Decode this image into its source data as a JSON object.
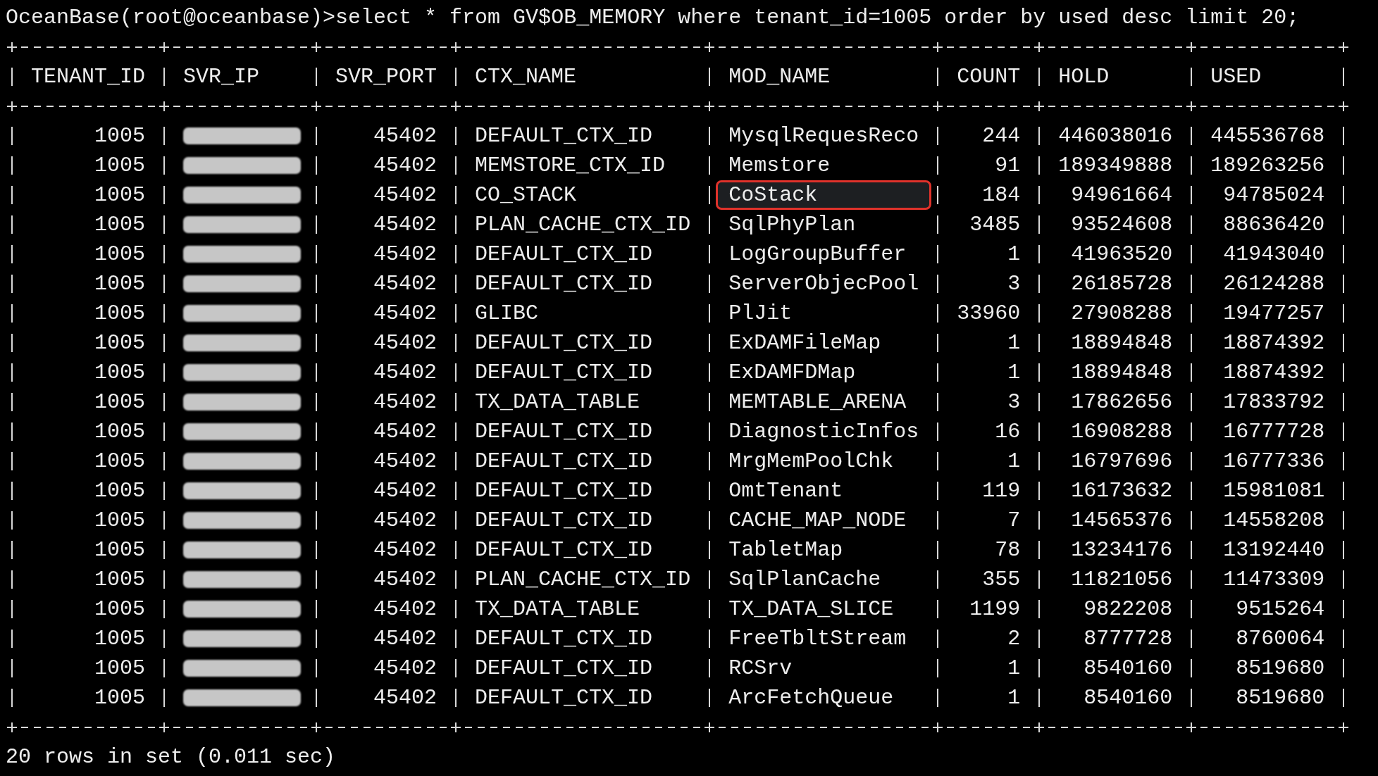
{
  "terminal": {
    "command": "OceanBase(root@oceanbase)>select * from GV$OB_MEMORY where tenant_id=1005 order by used desc limit 20;",
    "table": {
      "columns": [
        {
          "label": "TENANT_ID",
          "kind": "number"
        },
        {
          "label": "SVR_IP",
          "kind": "redacted"
        },
        {
          "label": "SVR_PORT",
          "kind": "number"
        },
        {
          "label": "CTX_NAME",
          "kind": "text"
        },
        {
          "label": "MOD_NAME",
          "kind": "text"
        },
        {
          "label": "COUNT",
          "kind": "number"
        },
        {
          "label": "HOLD",
          "kind": "number"
        },
        {
          "label": "USED",
          "kind": "number"
        }
      ],
      "rows": [
        {
          "cells": [
            "1005",
            "",
            "45402",
            "DEFAULT_CTX_ID",
            "MysqlRequesReco",
            "244",
            "446038016",
            "445536768"
          ],
          "ip_redacted": true,
          "highlighted": false
        },
        {
          "cells": [
            "1005",
            "",
            "45402",
            "MEMSTORE_CTX_ID",
            "Memstore",
            "91",
            "189349888",
            "189263256"
          ],
          "ip_redacted": true,
          "highlighted": false
        },
        {
          "cells": [
            "1005",
            "",
            "45402",
            "CO_STACK",
            "CoStack",
            "184",
            "94961664",
            "94785024"
          ],
          "ip_redacted": true,
          "highlighted": true
        },
        {
          "cells": [
            "1005",
            "",
            "45402",
            "PLAN_CACHE_CTX_ID",
            "SqlPhyPlan",
            "3485",
            "93524608",
            "88636420"
          ],
          "ip_redacted": true,
          "highlighted": false
        },
        {
          "cells": [
            "1005",
            "",
            "45402",
            "DEFAULT_CTX_ID",
            "LogGroupBuffer",
            "1",
            "41963520",
            "41943040"
          ],
          "ip_redacted": true,
          "highlighted": false
        },
        {
          "cells": [
            "1005",
            "",
            "45402",
            "DEFAULT_CTX_ID",
            "ServerObjecPool",
            "3",
            "26185728",
            "26124288"
          ],
          "ip_redacted": true,
          "highlighted": false
        },
        {
          "cells": [
            "1005",
            "",
            "45402",
            "GLIBC",
            "PlJit",
            "33960",
            "27908288",
            "19477257"
          ],
          "ip_redacted": true,
          "highlighted": false
        },
        {
          "cells": [
            "1005",
            "",
            "45402",
            "DEFAULT_CTX_ID",
            "ExDAMFileMap",
            "1",
            "18894848",
            "18874392"
          ],
          "ip_redacted": true,
          "highlighted": false
        },
        {
          "cells": [
            "1005",
            "",
            "45402",
            "DEFAULT_CTX_ID",
            "ExDAMFDMap",
            "1",
            "18894848",
            "18874392"
          ],
          "ip_redacted": true,
          "highlighted": false
        },
        {
          "cells": [
            "1005",
            "",
            "45402",
            "TX_DATA_TABLE",
            "MEMTABLE_ARENA",
            "3",
            "17862656",
            "17833792"
          ],
          "ip_redacted": true,
          "highlighted": false
        },
        {
          "cells": [
            "1005",
            "",
            "45402",
            "DEFAULT_CTX_ID",
            "DiagnosticInfos",
            "16",
            "16908288",
            "16777728"
          ],
          "ip_redacted": true,
          "highlighted": false
        },
        {
          "cells": [
            "1005",
            "",
            "45402",
            "DEFAULT_CTX_ID",
            "MrgMemPoolChk",
            "1",
            "16797696",
            "16777336"
          ],
          "ip_redacted": true,
          "highlighted": false
        },
        {
          "cells": [
            "1005",
            "",
            "45402",
            "DEFAULT_CTX_ID",
            "OmtTenant",
            "119",
            "16173632",
            "15981081"
          ],
          "ip_redacted": true,
          "highlighted": false
        },
        {
          "cells": [
            "1005",
            "",
            "45402",
            "DEFAULT_CTX_ID",
            "CACHE_MAP_NODE",
            "7",
            "14565376",
            "14558208"
          ],
          "ip_redacted": true,
          "highlighted": false
        },
        {
          "cells": [
            "1005",
            "",
            "45402",
            "DEFAULT_CTX_ID",
            "TabletMap",
            "78",
            "13234176",
            "13192440"
          ],
          "ip_redacted": true,
          "highlighted": false
        },
        {
          "cells": [
            "1005",
            "",
            "45402",
            "PLAN_CACHE_CTX_ID",
            "SqlPlanCache",
            "355",
            "11821056",
            "11473309"
          ],
          "ip_redacted": true,
          "highlighted": false
        },
        {
          "cells": [
            "1005",
            "",
            "45402",
            "TX_DATA_TABLE",
            "TX_DATA_SLICE",
            "1199",
            "9822208",
            "9515264"
          ],
          "ip_redacted": true,
          "highlighted": false
        },
        {
          "cells": [
            "1005",
            "",
            "45402",
            "DEFAULT_CTX_ID",
            "FreeTbltStream",
            "2",
            "8777728",
            "8760064"
          ],
          "ip_redacted": true,
          "highlighted": false
        },
        {
          "cells": [
            "1005",
            "",
            "45402",
            "DEFAULT_CTX_ID",
            "RCSrv",
            "1",
            "8540160",
            "8519680"
          ],
          "ip_redacted": true,
          "highlighted": false
        },
        {
          "cells": [
            "1005",
            "",
            "45402",
            "DEFAULT_CTX_ID",
            "ArcFetchQueue",
            "1",
            "8540160",
            "8519680"
          ],
          "ip_redacted": true,
          "highlighted": false
        }
      ]
    },
    "result": "20 rows in set (0.011 sec)"
  }
}
